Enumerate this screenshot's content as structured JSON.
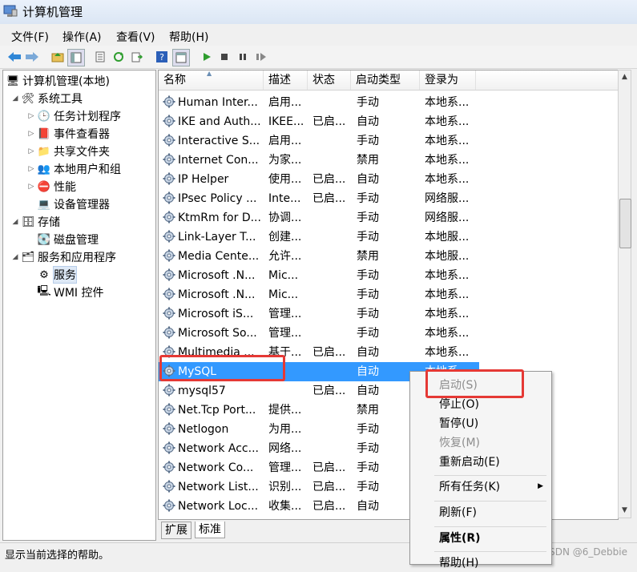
{
  "window": {
    "title": "计算机管理"
  },
  "menu": [
    "文件(F)",
    "操作(A)",
    "查看(V)",
    "帮助(H)"
  ],
  "tree": {
    "root": "计算机管理(本地)",
    "system_tools": "系统工具",
    "task_scheduler": "任务计划程序",
    "event_viewer": "事件查看器",
    "shared_folders": "共享文件夹",
    "local_users": "本地用户和组",
    "performance": "性能",
    "device_manager": "设备管理器",
    "storage": "存储",
    "disk_mgmt": "磁盘管理",
    "services_apps": "服务和应用程序",
    "services": "服务",
    "wmi": "WMI 控件"
  },
  "columns": [
    "名称",
    "描述",
    "状态",
    "启动类型",
    "登录为"
  ],
  "rows": [
    {
      "name": "Human Inter...",
      "desc": "启用...",
      "status": "",
      "startup": "手动",
      "logon": "本地系..."
    },
    {
      "name": "IKE and Auth...",
      "desc": "IKEE...",
      "status": "已启...",
      "startup": "自动",
      "logon": "本地系..."
    },
    {
      "name": "Interactive S...",
      "desc": "启用...",
      "status": "",
      "startup": "手动",
      "logon": "本地系..."
    },
    {
      "name": "Internet Con...",
      "desc": "为家...",
      "status": "",
      "startup": "禁用",
      "logon": "本地系..."
    },
    {
      "name": "IP Helper",
      "desc": "使用...",
      "status": "已启...",
      "startup": "自动",
      "logon": "本地系..."
    },
    {
      "name": "IPsec Policy ...",
      "desc": "Inte...",
      "status": "已启...",
      "startup": "手动",
      "logon": "网络服..."
    },
    {
      "name": "KtmRm for D...",
      "desc": "协调...",
      "status": "",
      "startup": "手动",
      "logon": "网络服..."
    },
    {
      "name": "Link-Layer T...",
      "desc": "创建...",
      "status": "",
      "startup": "手动",
      "logon": "本地服..."
    },
    {
      "name": "Media Cente...",
      "desc": "允许...",
      "status": "",
      "startup": "禁用",
      "logon": "本地服..."
    },
    {
      "name": "Microsoft .N...",
      "desc": "Mic...",
      "status": "",
      "startup": "手动",
      "logon": "本地系..."
    },
    {
      "name": "Microsoft .N...",
      "desc": "Mic...",
      "status": "",
      "startup": "手动",
      "logon": "本地系..."
    },
    {
      "name": "Microsoft iS...",
      "desc": "管理...",
      "status": "",
      "startup": "手动",
      "logon": "本地系..."
    },
    {
      "name": "Microsoft So...",
      "desc": "管理...",
      "status": "",
      "startup": "手动",
      "logon": "本地系..."
    },
    {
      "name": "Multimedia ...",
      "desc": "基于...",
      "status": "已启...",
      "startup": "自动",
      "logon": "本地系..."
    },
    {
      "name": "MySQL",
      "desc": "",
      "status": "",
      "startup": "自动",
      "logon": "本地系..."
    },
    {
      "name": "mysql57",
      "desc": "",
      "status": "已启...",
      "startup": "自动",
      "logon": ""
    },
    {
      "name": "Net.Tcp Port...",
      "desc": "提供...",
      "status": "",
      "startup": "禁用",
      "logon": ""
    },
    {
      "name": "Netlogon",
      "desc": "为用...",
      "status": "",
      "startup": "手动",
      "logon": ""
    },
    {
      "name": "Network Acc...",
      "desc": "网络...",
      "status": "",
      "startup": "手动",
      "logon": ""
    },
    {
      "name": "Network Co...",
      "desc": "管理...",
      "status": "已启...",
      "startup": "手动",
      "logon": ""
    },
    {
      "name": "Network List...",
      "desc": "识别...",
      "status": "已启...",
      "startup": "手动",
      "logon": ""
    },
    {
      "name": "Network Loc...",
      "desc": "收集...",
      "status": "已启...",
      "startup": "自动",
      "logon": ""
    }
  ],
  "tabs": [
    "扩展",
    "标准"
  ],
  "context_menu": {
    "start": "启动(S)",
    "stop": "停止(O)",
    "pause": "暂停(U)",
    "resume": "恢复(M)",
    "restart": "重新启动(E)",
    "all_tasks": "所有任务(K)",
    "refresh": "刷新(F)",
    "properties": "属性(R)",
    "help": "帮助(H)"
  },
  "status_text": "显示当前选择的帮助。",
  "watermark": "CSDN @6_Debbie"
}
